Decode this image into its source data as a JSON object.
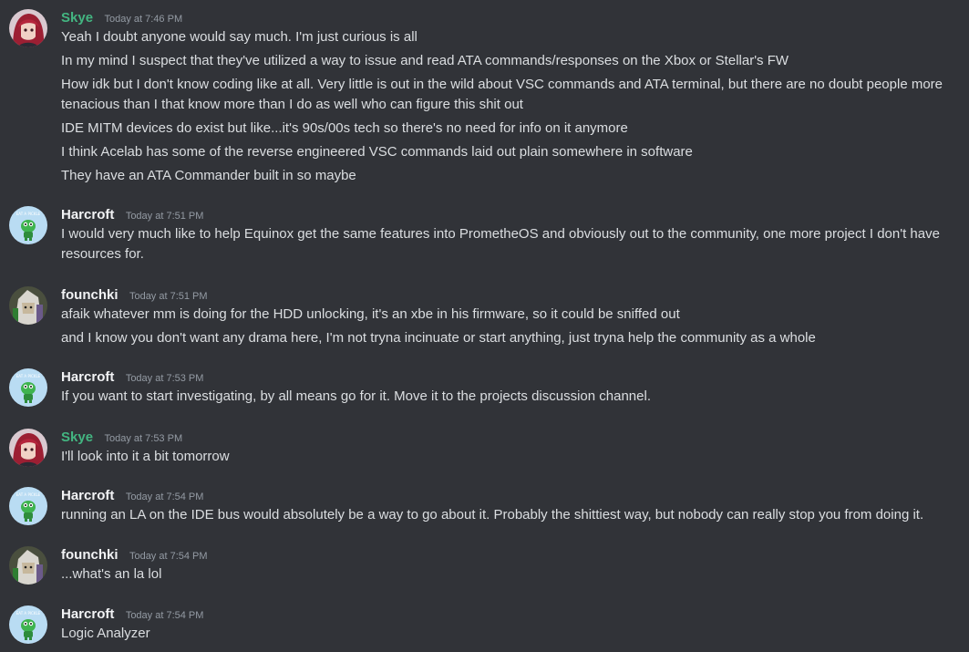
{
  "colors": {
    "background": "#313338",
    "text": "#dbdee1",
    "timestamp": "#949ba4",
    "skye_name": "#43b581",
    "other_name": "#f2f3f5"
  },
  "messages": [
    {
      "author": "Skye",
      "time": "Today at 7:46 PM",
      "avatar": "skye-avatar",
      "lines": [
        "Yeah I doubt anyone would say much. I'm just curious is all",
        "In my mind I suspect that they've utilized a way to issue and read ATA commands/responses on the Xbox or Stellar's FW",
        "How idk but I don't know coding like at all. Very little is out in the wild about VSC commands and ATA terminal, but there are no doubt people more tenacious than I that know more than I do as well who can figure this shit out",
        "IDE MITM devices do exist but like...it's 90s/00s tech so there's no need for info on it anymore",
        "I think Acelab has some of the reverse engineered VSC commands laid out plain somewhere in software",
        "They have an ATA Commander built in so maybe"
      ]
    },
    {
      "author": "Harcroft",
      "time": "Today at 7:51 PM",
      "avatar": "harcroft-avatar",
      "lines": [
        "I would very much like to help Equinox get the same features into PrometheOS and obviously out to the community, one more project I don't have resources for."
      ]
    },
    {
      "author": "founchki",
      "time": "Today at 7:51 PM",
      "avatar": "founchki-avatar",
      "lines": [
        "afaik whatever mm is doing for the HDD unlocking, it's an xbe in his firmware, so it could be sniffed out",
        "and I know you don't want any drama here, I'm not tryna incinuate or start anything, just tryna help the community as a whole"
      ]
    },
    {
      "author": "Harcroft",
      "time": "Today at 7:53 PM",
      "avatar": "harcroft-avatar",
      "lines": [
        "If you want to start investigating, by all means go for it. Move it to the projects discussion channel."
      ]
    },
    {
      "author": "Skye",
      "time": "Today at 7:53 PM",
      "avatar": "skye-avatar",
      "lines": [
        "I'll look into it a bit tomorrow"
      ]
    },
    {
      "author": "Harcroft",
      "time": "Today at 7:54 PM",
      "avatar": "harcroft-avatar",
      "lines": [
        "running an LA on the IDE bus would absolutely be a way to go about it. Probably the shittiest way, but nobody can really stop you from doing it."
      ]
    },
    {
      "author": "founchki",
      "time": "Today at 7:54 PM",
      "avatar": "founchki-avatar",
      "lines": [
        "...what's an la lol"
      ]
    },
    {
      "author": "Harcroft",
      "time": "Today at 7:54 PM",
      "avatar": "harcroft-avatar",
      "lines": [
        "Logic Analyzer"
      ]
    }
  ]
}
